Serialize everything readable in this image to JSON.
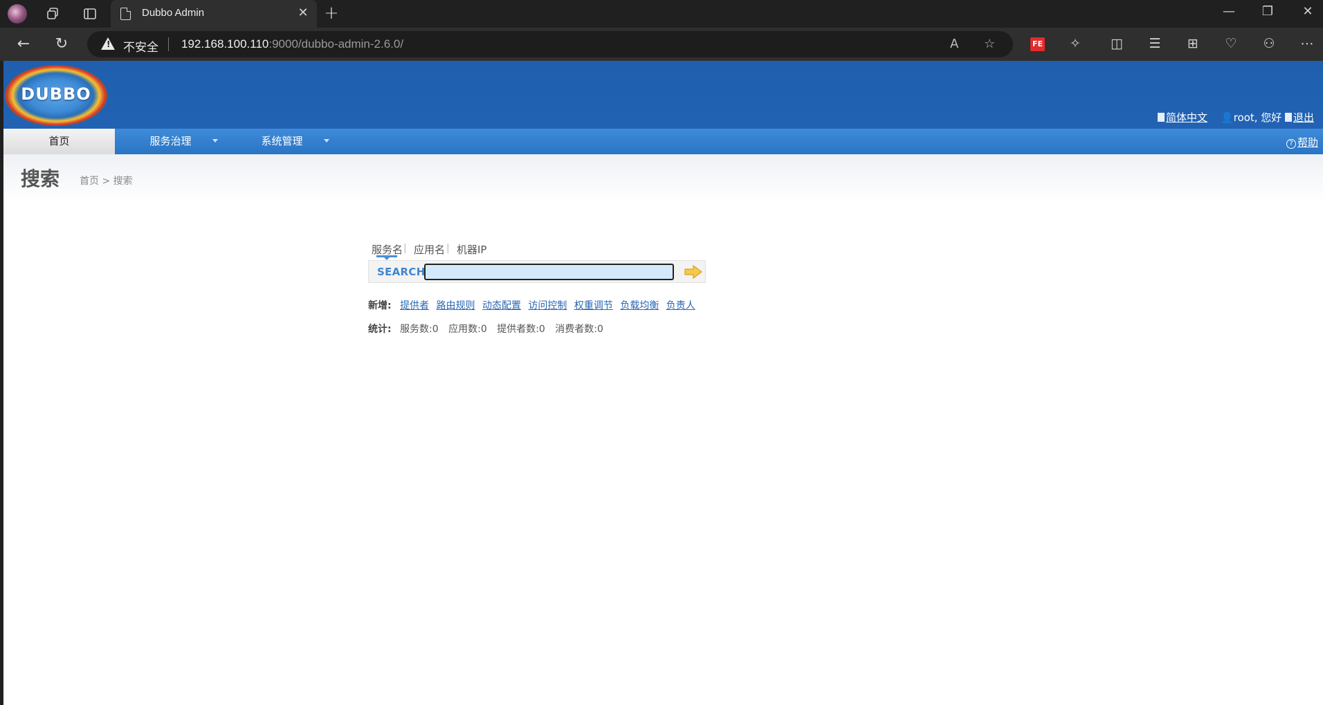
{
  "browser": {
    "tab_title": "Dubbo Admin",
    "insecure_label": "不安全",
    "url_host": "192.168.100.110",
    "url_rest": ":9000/dubbo-admin-2.6.0/",
    "ext_fe": "FE"
  },
  "header": {
    "logo_text": "DUBBO",
    "language": "简体中文",
    "greeting": "root, 您好",
    "logout": "退出"
  },
  "menu": {
    "items": [
      {
        "label": "首页"
      },
      {
        "label": "服务治理"
      },
      {
        "label": "系统管理"
      }
    ],
    "help": "帮助"
  },
  "page": {
    "title": "搜索",
    "breadcrumb": "首页 > 搜索"
  },
  "search": {
    "tabs": [
      "服务名",
      "应用名",
      "机器IP"
    ],
    "label": "SEARCH",
    "value": ""
  },
  "create": {
    "label": "新增:",
    "links": [
      "提供者",
      "路由规则",
      "动态配置",
      "访问控制",
      "权重调节",
      "负载均衡",
      "负责人"
    ]
  },
  "stats": {
    "label": "统计:",
    "items": [
      "服务数:0",
      "应用数:0",
      "提供者数:0",
      "消费者数:0"
    ]
  }
}
